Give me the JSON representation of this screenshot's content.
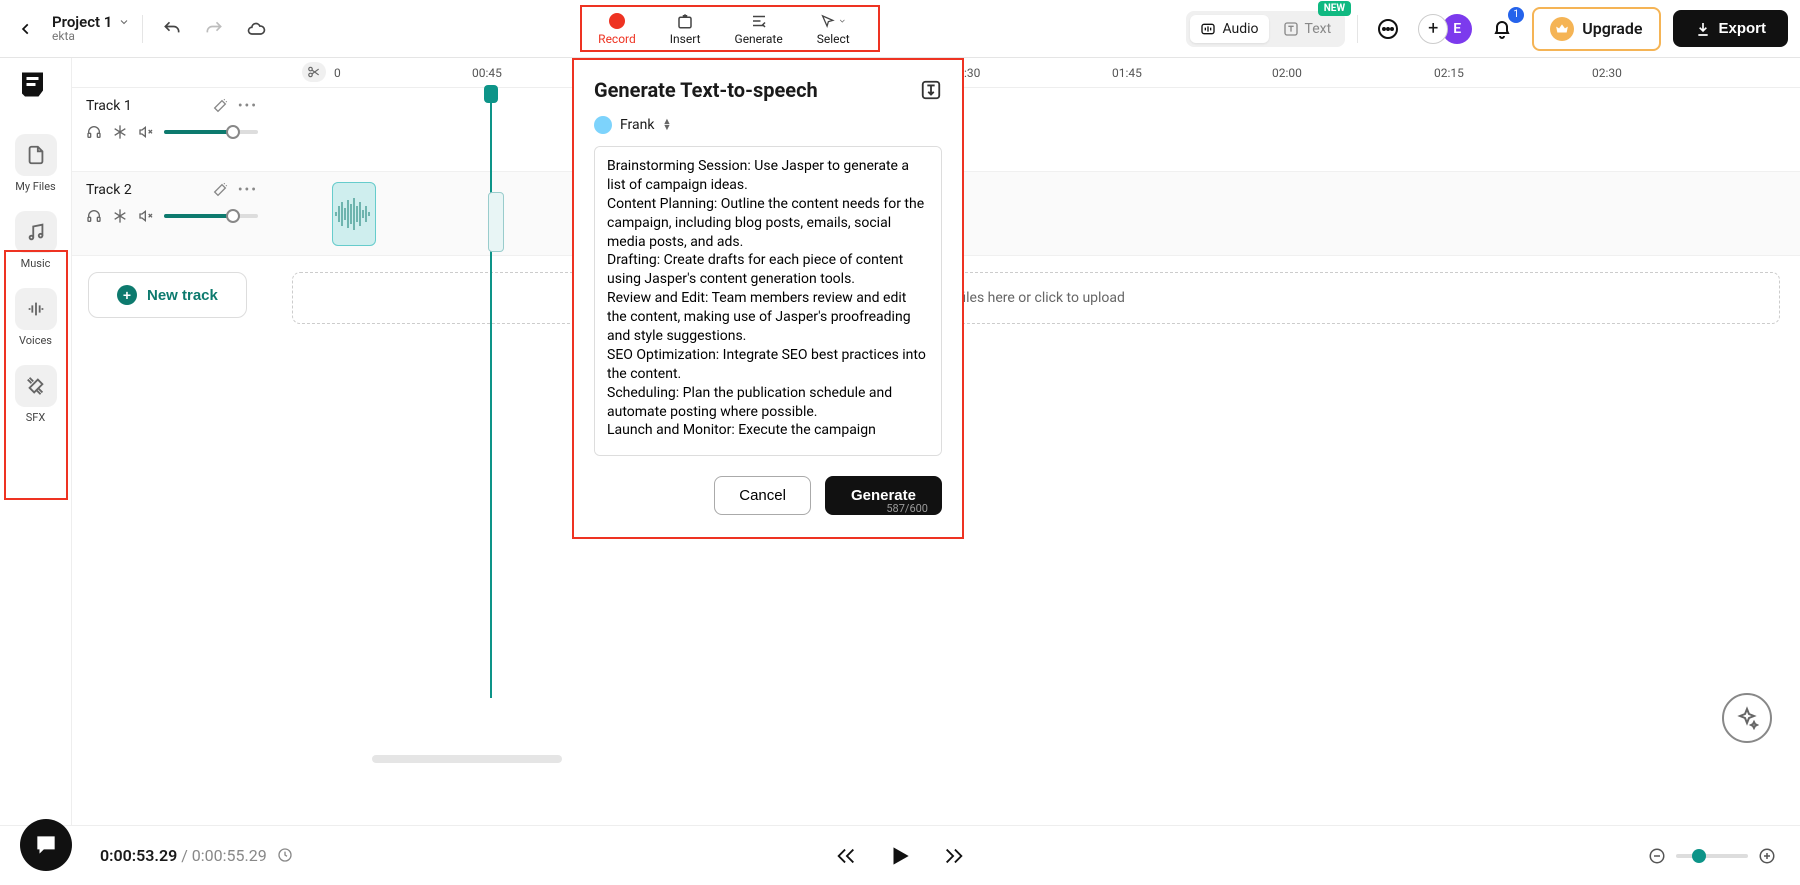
{
  "header": {
    "project_name": "Project 1",
    "project_owner": "ekta",
    "tools": {
      "record": "Record",
      "insert": "Insert",
      "generate": "Generate",
      "select": "Select"
    },
    "mode": {
      "audio": "Audio",
      "text": "Text",
      "new_badge": "NEW"
    },
    "avatar_initial": "E",
    "notif_count": "1",
    "upgrade": "Upgrade",
    "export": "Export"
  },
  "sidebar": {
    "my_files": "My Files",
    "music": "Music",
    "voices": "Voices",
    "sfx": "SFX"
  },
  "ruler": {
    "zero": "0",
    "marks": [
      "00:45",
      ":30",
      "01:45",
      "02:00",
      "02:15",
      "02:30"
    ]
  },
  "tracks": [
    {
      "name": "Track 1"
    },
    {
      "name": "Track 2"
    }
  ],
  "new_track": "New track",
  "drop_hint": "p files here or click to upload",
  "tts": {
    "title": "Generate Text-to-speech",
    "voice": "Frank",
    "text": "Brainstorming Session: Use Jasper to generate a list of campaign ideas.\nContent Planning: Outline the content needs for the campaign, including blog posts, emails, social media posts, and ads.\nDrafting: Create drafts for each piece of content using Jasper's content generation tools.\nReview and Edit: Team members review and edit the content, making use of Jasper's proofreading and style suggestions.\nSEO Optimization: Integrate SEO best practices into the content.\nScheduling: Plan the publication schedule and automate posting where possible.\nLaunch and Monitor: Execute the campaign",
    "count": "587/600",
    "cancel": "Cancel",
    "generate": "Generate"
  },
  "footer": {
    "current": "0:00:53.29",
    "sep": " / ",
    "duration": "0:00:55.29"
  }
}
